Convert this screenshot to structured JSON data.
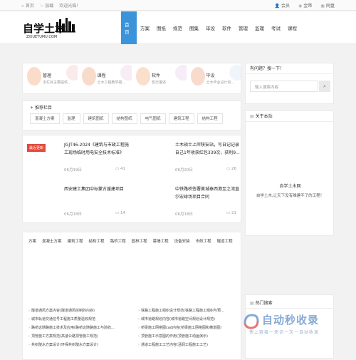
{
  "topbar": {
    "left": [
      "首页",
      "加载",
      "欢迎光临！"
    ],
    "right": [
      "会员",
      "金幣",
      "网盘"
    ]
  },
  "logo": {
    "text": "自学土木",
    "sub": "ZIXUETUMU.COM"
  },
  "nav": [
    "首页",
    "方案",
    "图纸",
    "规范",
    "图集",
    "毕设",
    "软件",
    "管理",
    "监理",
    "考试",
    "课程"
  ],
  "categories": [
    {
      "name": "管理",
      "desc": "本栏目主要提供...",
      "color": "#fadcc8",
      "bg": "#f3d2d0"
    },
    {
      "name": "课程",
      "desc": "土木工程教学视...",
      "color": "#f8dccb",
      "bg": "#f0d8e6"
    },
    {
      "name": "软件",
      "desc": "暂无描述",
      "color": "#f9dfcc",
      "bg": "#ead7ef"
    },
    {
      "name": "毕设",
      "desc": "土木毕业设计资...",
      "color": "#f8dbcc",
      "bg": "#dde8f6"
    }
  ],
  "recommend": {
    "title": "推荐栏目",
    "tags": [
      "混凝土方案",
      "监理",
      "建筑图纸",
      "结构图纸",
      "电气图纸",
      "建筑工程",
      "结构工程"
    ]
  },
  "posts": [
    {
      "badge": "最近更新",
      "title": "JGJT46-2024《建筑与市政工程施工现场临时用电安全技术标准》",
      "date": "06月19日",
      "comments": "41"
    },
    {
      "badge": "",
      "title": "土木硕士上岸陕安站，写日记记录自己1年收获红包339次，获利9...",
      "date": "06月20日",
      "comments": "26"
    },
    {
      "badge": "",
      "title": "西安建工集团中标蒙古援建项目",
      "date": "06月18日",
      "comments": "14"
    },
    {
      "badge": "",
      "title": "中铁路桥签署黄城泰西港至之湾直尔宏球场项目合同",
      "date": "06月18日",
      "comments": "21"
    }
  ],
  "tabs": [
    "方案",
    "混凝土方案",
    "建筑工程",
    "结构工程",
    "路桥工程",
    "园林工程",
    "幕墙工程",
    "设备安装",
    "市政工程",
    "隧道工程"
  ],
  "list_left": [
    "隧道通风方案内容(隧道通风控制的内容)",
    "城市轨道交通信号工程施工质量验收规范",
    "路桥这随路施工技术及应用(路桥这随路施工与验收...",
    "顶管施工方案规范(高速公路顶管施工规范)",
    "共织隧水方案设计(环保共织隧水方案设计)"
  ],
  "list_right": [
    "铁路工程施工组织设计规范(铁路工程施工组织与预...",
    "城市道路规划内容(城市道路空间规划设计规范)",
    "桥梁施工网络图cad内容(桥梁施工网络图和横道图)",
    "顶管施工示意图的作用(顶管施工动画演示)",
    "通道工程施工工艺内容(涵洞工程施工工艺)"
  ],
  "side_search": {
    "title": "有问题？搜一下！",
    "placeholder": "输入搜索内容"
  },
  "side_about": {
    "title": "关于本站",
    "name": "自学土木网",
    "desc": "自学土木,让天下没有难建不了的工程！"
  },
  "side_hot": {
    "title": "热门搜索"
  },
  "watermark": {
    "main": "自动秒收录",
    "sub": "快上链接一来访一次一自动收录"
  }
}
